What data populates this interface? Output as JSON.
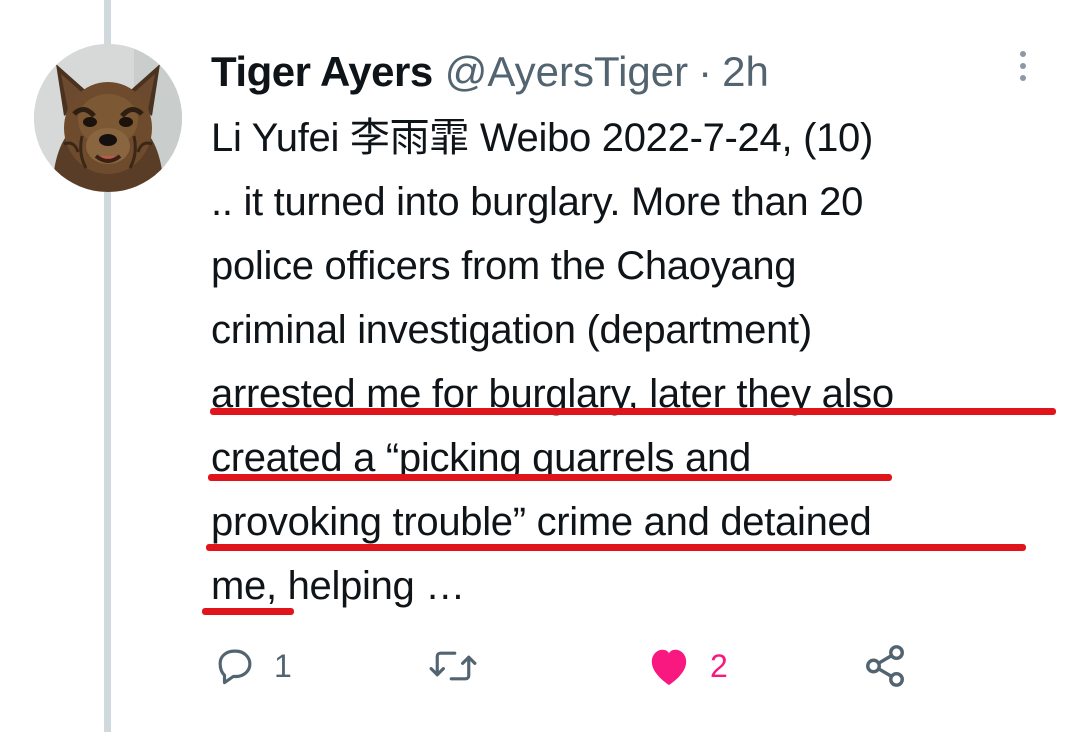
{
  "tweet": {
    "display_name": "Tiger Ayers",
    "handle": "@AyersTiger",
    "separator": "·",
    "time": "2h",
    "lines": [
      "Li Yufei 李雨霏 Weibo 2022-7-24, (10)",
      ".. it turned into burglary. More than 20",
      "police officers from the Chaoyang",
      "criminal investigation (department)",
      "arrested me for burglary, later they also",
      "created a “picking quarrels and",
      "provoking trouble” crime and detained",
      "me, helping …"
    ]
  },
  "actions": {
    "reply_count": "1",
    "like_count": "2"
  },
  "colors": {
    "underline": "#e0141b",
    "like": "#f91880",
    "secondary_text": "#536471"
  },
  "icons": [
    "more-icon",
    "reply-icon",
    "retweet-icon",
    "heart-icon",
    "share-icon"
  ]
}
